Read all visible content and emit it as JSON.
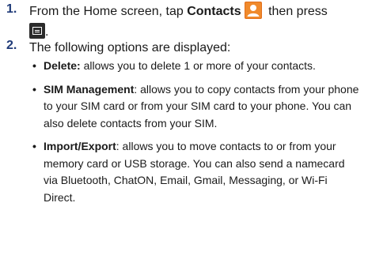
{
  "steps": [
    {
      "number": "1.",
      "text_before": "From the Home screen, tap ",
      "bold": "Contacts",
      "text_mid": " then press",
      "text_after": "."
    },
    {
      "number": "2.",
      "text": "The following options are displayed:"
    }
  ],
  "bullets": [
    {
      "term": "Delete:",
      "desc": " allows you to delete 1 or more of your contacts."
    },
    {
      "term": "SIM Management",
      "desc": ": allows you to copy contacts from your phone to your SIM card or from your SIM card to your phone. You can also delete contacts from your SIM."
    },
    {
      "term": "Import/Export",
      "desc": ": allows you to move contacts to or from your memory card or USB storage. You can also send a namecard via Bluetooth, ChatON, Email, Gmail, Messaging, or Wi-Fi Direct."
    }
  ],
  "icons": {
    "contacts": "contacts-icon",
    "menu": "menu-key-icon"
  },
  "colors": {
    "step_number": "#1f3a78",
    "contacts_icon_bg": "#e2701c",
    "menu_key_bg": "#2b2b2b"
  }
}
